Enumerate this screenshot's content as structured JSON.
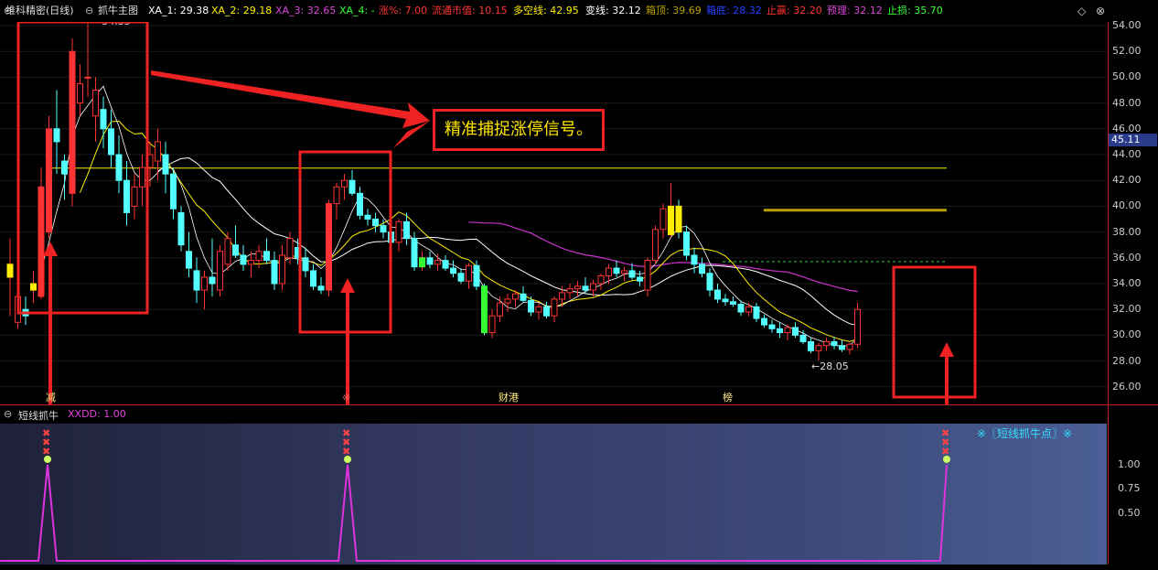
{
  "topbar": {
    "title": "维科精密(日线)",
    "indicator": "抓牛主图",
    "xa1": "XA_1: 29.38",
    "xa2": "XA_2: 29.18",
    "xa3": "XA_3: 32.65",
    "xa4": "XA_4: -",
    "zhang": "涨%: 7.00",
    "liutong": "流通市值: 10.15",
    "duokong": "多空线: 42.95",
    "bianxian": "变线: 32.12",
    "xiangding": "箱顶: 39.69",
    "xiangdi": "箱底: 28.32",
    "zhiying": "止赢: 32.20",
    "yuli": "预理: 32.12",
    "zhisun": "止损: 35.70",
    "diamond_icon": "diamond-icon",
    "close_icon": "close-icon"
  },
  "main_chart": {
    "y_ticks": [
      "54.00",
      "52.00",
      "50.00",
      "48.00",
      "46.00",
      "44.00",
      "42.00",
      "40.00",
      "38.00",
      "36.00",
      "34.00",
      "32.00",
      "30.00",
      "28.00",
      "26.00"
    ],
    "current_price": "45.11",
    "high_label": "54.35",
    "low_label": "28.05",
    "callout": "精准捕捉涨停信号。",
    "event_markers": [
      "减",
      "※",
      "财港",
      "榜"
    ]
  },
  "sub_chart": {
    "title": "短线抓牛",
    "xxdd": "XXDD: 1.00",
    "legend": "※〖短线抓牛点〗※",
    "y_ticks": [
      "1.00",
      "0.75",
      "0.50"
    ]
  },
  "colors": {
    "up": "#ff3333",
    "down": "#54ffff",
    "yellow": "#ffee00",
    "magenta": "#cc33cc",
    "green": "#33ff33",
    "frame": "#ee2222"
  },
  "chart_data": {
    "type": "candlestick",
    "title": "维科精密(日线)",
    "ylim": [
      25,
      55
    ],
    "candles": [
      [
        34.5,
        37.5,
        31.5,
        35.5
      ],
      [
        31,
        34.5,
        30.5,
        33
      ],
      [
        32,
        33,
        30.8,
        31.5
      ],
      [
        33.5,
        35,
        32.5,
        34
      ],
      [
        33,
        43,
        32.8,
        41.5
      ],
      [
        38,
        47,
        37.5,
        46
      ],
      [
        46,
        49,
        42.5,
        45
      ],
      [
        43.5,
        44,
        40.5,
        42.5
      ],
      [
        41,
        53,
        40,
        52
      ],
      [
        48,
        51,
        47,
        49.5
      ],
      [
        50,
        54.35,
        48.5,
        50
      ],
      [
        47,
        50,
        45,
        49
      ],
      [
        47.5,
        48.5,
        44.5,
        46
      ],
      [
        46,
        47.5,
        43,
        44
      ],
      [
        44,
        45.5,
        41,
        42
      ],
      [
        42,
        43.5,
        38.5,
        39.5
      ],
      [
        40,
        42.5,
        39,
        41.5
      ],
      [
        41.5,
        44,
        40,
        43
      ],
      [
        43,
        45,
        41.5,
        44
      ],
      [
        43.5,
        46,
        42,
        45
      ],
      [
        44,
        45,
        41,
        42.5
      ],
      [
        42.5,
        43,
        39,
        39.8
      ],
      [
        39.5,
        40,
        36.5,
        37
      ],
      [
        36.5,
        38,
        34.5,
        35.2
      ],
      [
        35,
        36,
        32.5,
        33.5
      ],
      [
        33.5,
        35,
        32,
        34.5
      ],
      [
        34.5,
        37.5,
        33,
        34
      ],
      [
        33.5,
        37,
        33,
        36.5
      ],
      [
        35.5,
        38,
        35,
        37.5
      ],
      [
        37,
        38.5,
        36,
        36.2
      ],
      [
        36.2,
        37,
        35,
        35.5
      ],
      [
        35.5,
        36.5,
        34.5,
        35.8
      ],
      [
        35.8,
        37,
        35.2,
        36.5
      ],
      [
        36.5,
        37.5,
        35.5,
        35.8
      ],
      [
        35.8,
        36.5,
        33.5,
        34
      ],
      [
        34,
        37,
        33.5,
        36.2
      ],
      [
        36,
        38,
        35.5,
        37.5
      ],
      [
        36.8,
        37.5,
        35.5,
        36
      ],
      [
        36,
        36.8,
        34.5,
        35
      ],
      [
        35,
        35.5,
        33.5,
        33.8
      ],
      [
        33.8,
        34.5,
        33.2,
        33.5
      ],
      [
        33.5,
        40.5,
        33,
        40.2
      ],
      [
        40.2,
        41.8,
        39,
        41.5
      ],
      [
        41.5,
        42.5,
        40.5,
        42
      ],
      [
        42,
        42.8,
        40.8,
        41
      ],
      [
        41,
        41.5,
        39,
        39.3
      ],
      [
        39.3,
        39.8,
        38.5,
        39
      ],
      [
        39,
        39.5,
        38,
        38.5
      ],
      [
        38.5,
        39,
        37.5,
        38
      ],
      [
        38,
        38.5,
        36,
        37.2
      ],
      [
        37.2,
        39,
        36.5,
        38.8
      ],
      [
        38.8,
        39.5,
        37,
        37.5
      ],
      [
        37.5,
        38,
        35,
        35.3
      ],
      [
        35.3,
        36.5,
        35,
        36
      ],
      [
        36,
        36.5,
        35.2,
        35.5
      ],
      [
        35.5,
        36.3,
        35,
        35.8
      ],
      [
        35.8,
        36.2,
        35,
        35.2
      ],
      [
        35.2,
        35.8,
        34.5,
        34.8
      ],
      [
        34.8,
        35.2,
        34,
        34.2
      ],
      [
        34.2,
        35.6,
        33.6,
        35.4
      ],
      [
        35.4,
        35.8,
        33.5,
        33.8
      ],
      [
        33.8,
        34,
        30,
        30.2
      ],
      [
        30.2,
        32,
        29.8,
        31.5
      ],
      [
        31.5,
        33,
        31,
        32.5
      ],
      [
        32.5,
        33.2,
        31.8,
        32.8
      ],
      [
        32.8,
        33.5,
        32.2,
        33.2
      ],
      [
        33.2,
        33.8,
        32.5,
        32.7
      ],
      [
        32.7,
        33,
        31.5,
        31.8
      ],
      [
        31.8,
        32.5,
        31.2,
        32.2
      ],
      [
        32.2,
        32.6,
        31.3,
        31.5
      ],
      [
        31.5,
        33,
        31,
        32.8
      ],
      [
        32.8,
        33.8,
        32.2,
        33.3
      ],
      [
        33.3,
        34,
        32.8,
        33.6
      ],
      [
        33.6,
        34.2,
        33,
        33.8
      ],
      [
        33.8,
        34.5,
        33.2,
        33.5
      ],
      [
        33.5,
        34.3,
        33,
        34
      ],
      [
        34,
        34.8,
        33.5,
        34.6
      ],
      [
        34.6,
        35.5,
        34,
        35.2
      ],
      [
        35.2,
        35.8,
        34.5,
        34.8
      ],
      [
        34.8,
        35.3,
        34.2,
        35
      ],
      [
        35,
        35.6,
        34.3,
        34.5
      ],
      [
        34.5,
        35,
        33.8,
        34.2
      ],
      [
        33.5,
        36,
        33,
        35.8
      ],
      [
        35.8,
        38.5,
        35.5,
        38.2
      ],
      [
        38.2,
        40.2,
        37.5,
        39.8
      ],
      [
        37.8,
        41.8,
        37.6,
        40
      ],
      [
        40,
        40.5,
        37.5,
        38
      ],
      [
        38,
        38.5,
        35.8,
        36.2
      ],
      [
        36.2,
        36.8,
        34.8,
        35.5
      ],
      [
        35.5,
        36,
        34.5,
        34.8
      ],
      [
        34.8,
        35.2,
        33,
        33.5
      ],
      [
        33.5,
        34,
        32.5,
        32.8
      ],
      [
        32.8,
        33.2,
        32.3,
        32.6
      ],
      [
        32.6,
        33,
        32.2,
        32.4
      ],
      [
        32.4,
        32.7,
        31.5,
        31.8
      ],
      [
        31.8,
        32.5,
        31.5,
        32.2
      ],
      [
        32.2,
        32.5,
        31,
        31.3
      ],
      [
        31.3,
        31.6,
        30.6,
        30.8
      ],
      [
        30.8,
        31.2,
        30.2,
        30.5
      ],
      [
        30.5,
        31,
        29.8,
        30.2
      ],
      [
        30.2,
        30.8,
        29.6,
        30.6
      ],
      [
        30.6,
        31,
        29.8,
        30
      ],
      [
        30,
        30.4,
        29.3,
        29.5
      ],
      [
        29.5,
        29.8,
        28.6,
        28.8
      ],
      [
        28.8,
        29.4,
        28.05,
        29.2
      ],
      [
        29.2,
        29.8,
        28.8,
        29.5
      ],
      [
        29.5,
        29.9,
        28.9,
        29.2
      ],
      [
        29.2,
        29.6,
        28.7,
        28.9
      ],
      [
        28.9,
        29.4,
        28.5,
        29.3
      ],
      [
        29.3,
        32.5,
        29,
        32
      ]
    ],
    "horizontal_lines": [
      {
        "name": "多空线",
        "value": 42.95
      },
      {
        "name": "箱顶",
        "value": 39.69
      },
      {
        "name": "止损",
        "value": 35.7
      }
    ],
    "signals": {
      "name": "XXDD",
      "values_at": [
        3,
        47,
        118
      ],
      "value": 1.0
    },
    "sub_ylim": [
      0,
      1.3
    ]
  }
}
